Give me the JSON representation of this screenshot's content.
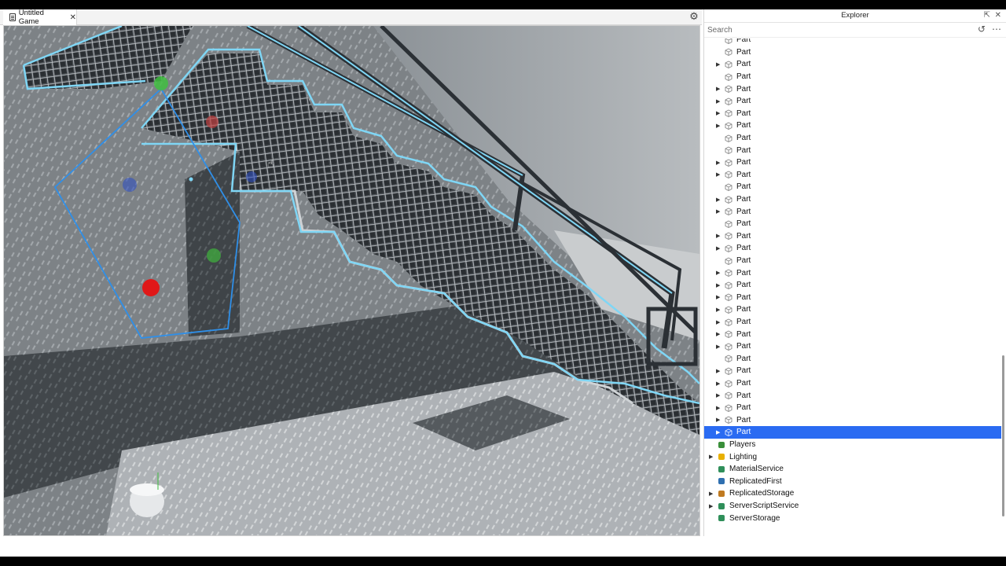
{
  "tab": {
    "title": "Untitled Game",
    "close": "✕"
  },
  "viewport": {
    "name": "3D viewport"
  },
  "explorer": {
    "title": "Explorer",
    "search_placeholder": "Search",
    "parts": [
      {
        "label": "Part",
        "expandable": false
      },
      {
        "label": "Part",
        "expandable": false
      },
      {
        "label": "Part",
        "expandable": true
      },
      {
        "label": "Part",
        "expandable": false
      },
      {
        "label": "Part",
        "expandable": true
      },
      {
        "label": "Part",
        "expandable": true
      },
      {
        "label": "Part",
        "expandable": true
      },
      {
        "label": "Part",
        "expandable": true
      },
      {
        "label": "Part",
        "expandable": false
      },
      {
        "label": "Part",
        "expandable": false
      },
      {
        "label": "Part",
        "expandable": true
      },
      {
        "label": "Part",
        "expandable": true
      },
      {
        "label": "Part",
        "expandable": false
      },
      {
        "label": "Part",
        "expandable": true
      },
      {
        "label": "Part",
        "expandable": true
      },
      {
        "label": "Part",
        "expandable": false
      },
      {
        "label": "Part",
        "expandable": true
      },
      {
        "label": "Part",
        "expandable": true
      },
      {
        "label": "Part",
        "expandable": false
      },
      {
        "label": "Part",
        "expandable": true
      },
      {
        "label": "Part",
        "expandable": true
      },
      {
        "label": "Part",
        "expandable": true
      },
      {
        "label": "Part",
        "expandable": true
      },
      {
        "label": "Part",
        "expandable": true
      },
      {
        "label": "Part",
        "expandable": true
      },
      {
        "label": "Part",
        "expandable": true
      },
      {
        "label": "Part",
        "expandable": false
      },
      {
        "label": "Part",
        "expandable": true
      },
      {
        "label": "Part",
        "expandable": true
      },
      {
        "label": "Part",
        "expandable": true
      },
      {
        "label": "Part",
        "expandable": true
      },
      {
        "label": "Part",
        "expandable": true
      },
      {
        "label": "Part",
        "expandable": true,
        "selected": true
      }
    ],
    "services": [
      {
        "label": "Players",
        "expandable": false,
        "icon": "players-icon",
        "color": "#3a8f3a"
      },
      {
        "label": "Lighting",
        "expandable": true,
        "icon": "lighting-icon",
        "color": "#e8b000"
      },
      {
        "label": "MaterialService",
        "expandable": false,
        "icon": "material-service-icon",
        "color": "#2f8f5a"
      },
      {
        "label": "ReplicatedFirst",
        "expandable": false,
        "icon": "replicated-first-icon",
        "color": "#2f6fb0"
      },
      {
        "label": "ReplicatedStorage",
        "expandable": true,
        "icon": "replicated-storage-icon",
        "color": "#c07a20"
      },
      {
        "label": "ServerScriptService",
        "expandable": true,
        "icon": "server-script-service-icon",
        "color": "#2f8f5a"
      },
      {
        "label": "ServerStorage",
        "expandable": false,
        "icon": "server-storage-icon",
        "color": "#2f8f5a"
      }
    ]
  },
  "colors": {
    "selection": "#2a6bf2",
    "outline": "#7fd6f5"
  }
}
